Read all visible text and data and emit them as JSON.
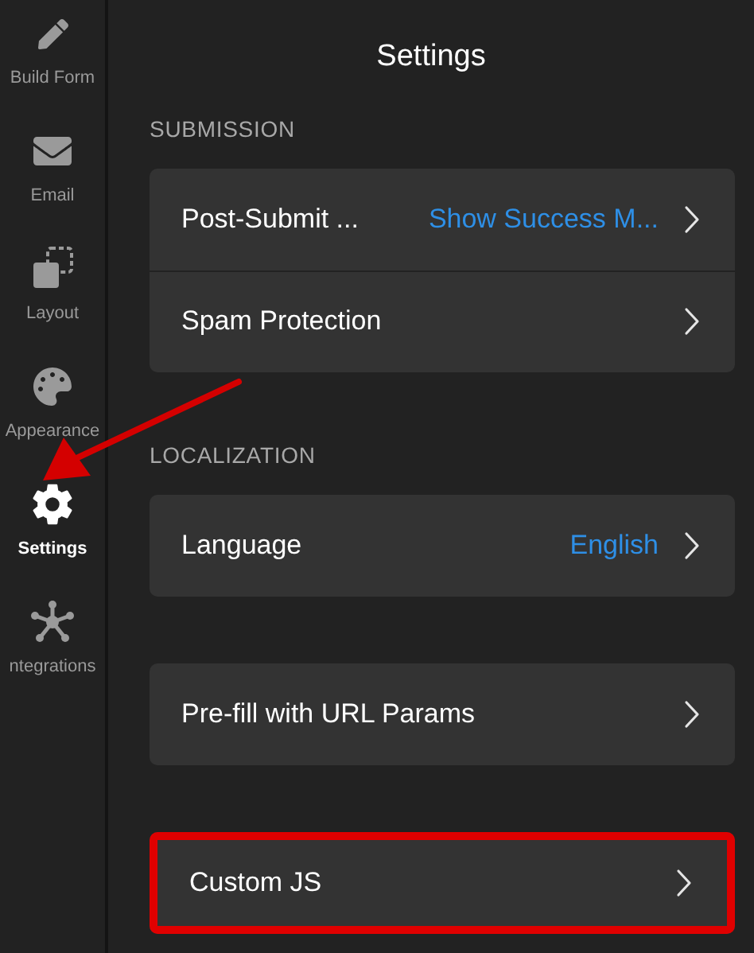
{
  "sidebar": {
    "items": [
      {
        "kind": "pen",
        "label": "Build Form",
        "selected": false
      },
      {
        "kind": "mail",
        "label": "Email",
        "selected": false
      },
      {
        "kind": "layout",
        "label": "Layout",
        "selected": false
      },
      {
        "kind": "palette",
        "label": "Appearance",
        "selected": false
      },
      {
        "kind": "gear",
        "label": "Settings",
        "selected": true
      },
      {
        "kind": "hub",
        "label": "ntegrations",
        "selected": false
      }
    ]
  },
  "title": "Settings",
  "sections": [
    {
      "header": "SUBMISSION",
      "rows": [
        {
          "label": "Post-Submit ...",
          "value": "Show Success M...",
          "highlighted": false
        },
        {
          "label": "Spam Protection",
          "highlighted": false
        }
      ]
    },
    {
      "header": "LOCALIZATION",
      "rows": [
        {
          "label": "Language",
          "value": "English",
          "highlighted": false
        }
      ]
    },
    {
      "rows": [
        {
          "label": "Pre-fill with URL Params",
          "highlighted": false
        }
      ]
    },
    {
      "rows": [
        {
          "label": "Custom JS",
          "highlighted": true
        }
      ]
    }
  ],
  "annotation": {
    "kind": "arrow"
  }
}
